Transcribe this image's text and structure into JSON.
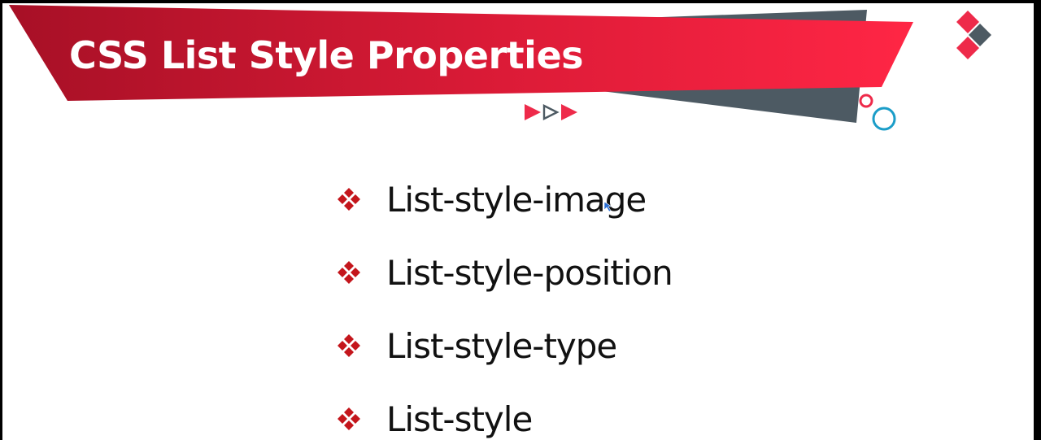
{
  "slide": {
    "title": "CSS List Style Properties",
    "bullets": [
      {
        "label": "List-style-image",
        "icon": "diamond-cluster-icon"
      },
      {
        "label": "List-style-position",
        "icon": "diamond-cluster-icon"
      },
      {
        "label": "List-style-type",
        "icon": "diamond-cluster-icon"
      },
      {
        "label": "List-style",
        "icon": "diamond-cluster-icon"
      }
    ]
  },
  "decorations": {
    "title_band_color": "#e8203f",
    "title_band_dark_color": "#a71026",
    "shadow_band_color": "#4d5a63",
    "accent_pink": "#ee2a4a",
    "accent_teal": "#1b9dc8",
    "bullet_color": "#c4161c",
    "icons": [
      "play-arrows-icon",
      "diamond-logo-icon",
      "circles-icon",
      "mouse-cursor-icon"
    ]
  }
}
